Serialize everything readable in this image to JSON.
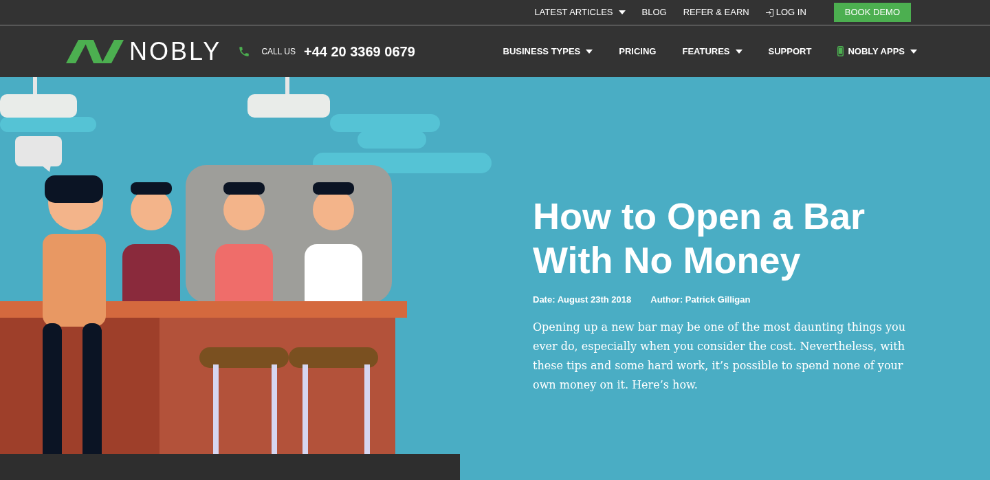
{
  "top_links": [
    {
      "label": "LATEST ARTICLES",
      "kind": "link",
      "dropdown": true
    },
    {
      "label": "BLOG",
      "kind": "link",
      "dropdown": false
    },
    {
      "label": "REFER & EARN",
      "kind": "link",
      "dropdown": false
    },
    {
      "label": "LOG IN",
      "kind": "login",
      "dropdown": false
    },
    {
      "label": "BOOK DEMO",
      "kind": "button",
      "dropdown": false
    }
  ],
  "header": {
    "logo": "NOBLY",
    "call_label": "CALL US",
    "phone": "+44 20 3369 0679"
  },
  "nav": [
    {
      "label": "BUSINESS TYPES",
      "kind": "link",
      "dropdown": true
    },
    {
      "label": "PRICING",
      "kind": "link",
      "dropdown": false
    },
    {
      "label": "FEATURES",
      "kind": "link",
      "dropdown": true
    },
    {
      "label": "SUPPORT",
      "kind": "link",
      "dropdown": false
    },
    {
      "label": "NOBLY APPS",
      "kind": "apps",
      "dropdown": true
    }
  ],
  "hero": {
    "title": "How to Open a Bar With No Money",
    "date": "Date: August 23th 2018",
    "author": "Author: Patrick Gilligan",
    "intro": "Opening up a new bar may be one of the most daunting things you ever do, especially when you consider the cost. Nevertheless, with these tips and some hard work, it’s possible to spend none of your own money on it. Here’s how."
  }
}
